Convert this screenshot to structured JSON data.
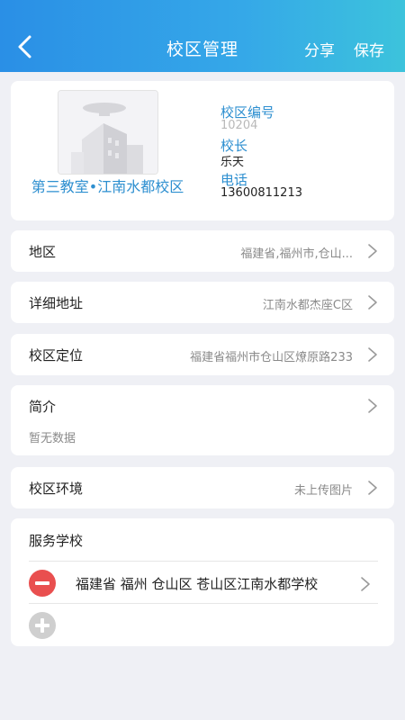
{
  "header": {
    "title": "校区管理",
    "share_label": "分享",
    "save_label": "保存"
  },
  "profile": {
    "campus_name": "第三教室•江南水都校区",
    "id_label": "校区编号",
    "id_value": "10204",
    "principal_label": "校长",
    "principal_value": "乐天",
    "phone_label": "电话",
    "phone_value": "13600811213"
  },
  "rows": {
    "region": {
      "label": "地区",
      "value": "福建省,福州市,仓山..."
    },
    "address": {
      "label": "详细地址",
      "value": "江南水都杰座C区"
    },
    "location": {
      "label": "校区定位",
      "value": "福建省福州市仓山区燎原路233"
    },
    "environment": {
      "label": "校区环境",
      "value": "未上传图片"
    }
  },
  "intro": {
    "label": "简介",
    "value": "暂无数据"
  },
  "schools": {
    "title": "服务学校",
    "items": [
      {
        "name": "福建省 福州 仓山区 苍山区江南水都学校"
      }
    ]
  }
}
